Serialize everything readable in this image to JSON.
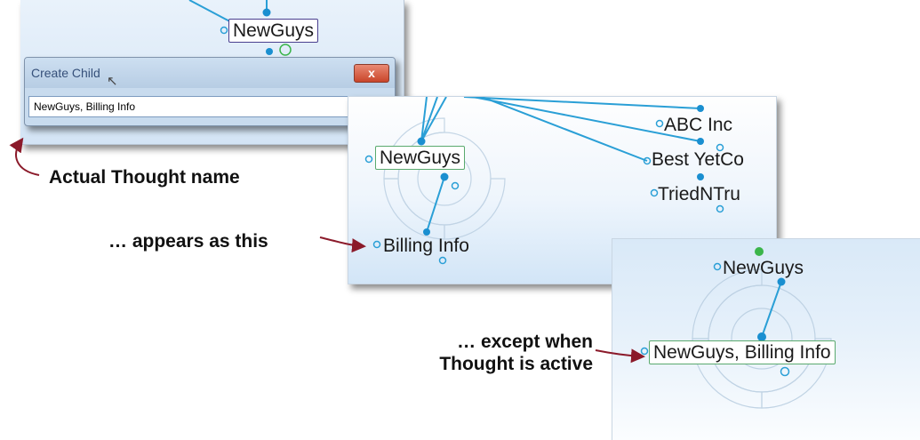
{
  "panel1": {
    "node_label": "NewGuys"
  },
  "dialog": {
    "title": "Create Child",
    "close_glyph": "x",
    "input_value": "NewGuys, Billing Info",
    "ok_glyph": "✓",
    "cancel_glyph": "✕"
  },
  "panel2": {
    "nodes": [
      "NewGuys",
      "ABC Inc",
      "Best YetCo",
      "TriedNTru",
      "Billing Info"
    ]
  },
  "panel3": {
    "parent_label": "NewGuys",
    "active_label": "NewGuys, Billing Info"
  },
  "annotations": {
    "actual_name": "Actual Thought name",
    "appears_as": "… appears as this",
    "except_when_line1": "… except when",
    "except_when_line2": "Thought is active"
  },
  "colors": {
    "link_line": "#2a9fd6",
    "node_dot": "#1a8fd0",
    "active_dot": "#3bb54a",
    "arrow": "#8b1a2a",
    "active_border": "#5aaa6e"
  }
}
